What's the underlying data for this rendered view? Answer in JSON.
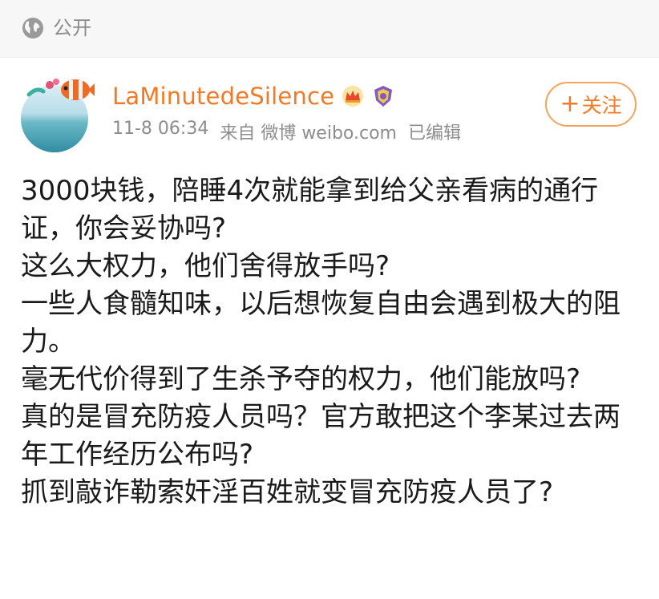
{
  "header": {
    "visibility_label": "公开",
    "visibility_icon": "globe-icon"
  },
  "post": {
    "author": "LaMinutedeSilence",
    "timestamp": "11-8 06:34",
    "source": "来自 微博 weibo.com",
    "edited": "已编辑",
    "follow_label": "关注",
    "badges": [
      "crown-badge-icon",
      "shield-badge-icon"
    ],
    "lines": [
      "3000块钱，陪睡4次就能拿到给父亲看病的通行证，你会妥协吗?",
      "这么大权力，他们舍得放手吗?",
      "一些人食髓知味，以后想恢复自由会遇到极大的阻力。",
      "毫无代价得到了生杀予夺的权力，他们能放吗?",
      "真的是冒充防疫人员吗？官方敢把这个李某过去两年工作经历公布吗?",
      "抓到敲诈勒索奸淫百姓就变冒充防疫人员了?"
    ]
  },
  "colors": {
    "accent": "#f07a26",
    "meta": "#8d8d8d"
  }
}
